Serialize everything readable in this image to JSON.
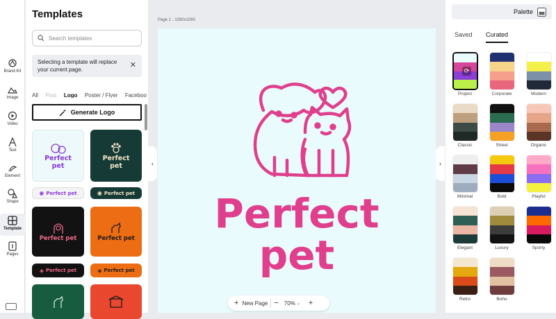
{
  "rail": [
    {
      "label": "Brand Kit",
      "icon": "brand-kit-icon"
    },
    {
      "label": "Image",
      "icon": "image-icon"
    },
    {
      "label": "Video",
      "icon": "video-icon"
    },
    {
      "label": "Text",
      "icon": "text-icon"
    },
    {
      "label": "Element",
      "icon": "element-icon"
    },
    {
      "label": "Shape",
      "icon": "shape-icon"
    },
    {
      "label": "Template",
      "icon": "template-icon",
      "active": true
    },
    {
      "label": "Pages",
      "icon": "pages-icon"
    }
  ],
  "templates": {
    "title": "Templates",
    "search_placeholder": "Search templates",
    "notice": "Selecting a template will replace your current page.",
    "tabs": [
      "All",
      "Post",
      "Logo",
      "Poster / Flyer",
      "Facebook"
    ],
    "active_tab": "Logo",
    "generate_label": "Generate Logo",
    "card_text": "Perfect pet",
    "card_text_a": "Perfect",
    "card_text_b": "pet"
  },
  "canvas": {
    "page_label": "Page 1 - 1080x1080",
    "headline_1": "Perfect",
    "headline_2": "pet",
    "brand_color": "#df3f8d",
    "background": "#e9fbfc"
  },
  "bottom_bar": {
    "new_page": "New Page",
    "zoom": "70%"
  },
  "palette": {
    "button_label": "Palette",
    "tabs": [
      "Saved",
      "Curated"
    ],
    "active_tab": "Curated",
    "swatches": [
      {
        "name": "Project",
        "colors": [
          "#e9fbfc",
          "#d6479c",
          "#8b3fd4",
          "#b9f04a"
        ],
        "selected": true
      },
      {
        "name": "Corporate",
        "colors": [
          "#1f3170",
          "#f6d48a",
          "#f59f8c",
          "#e9677c"
        ]
      },
      {
        "name": "Modern",
        "colors": [
          "#ffffff",
          "#f3f04a",
          "#7c90a8",
          "#1f2937"
        ]
      },
      {
        "name": "Classic",
        "colors": [
          "#e9dbc6",
          "#bfa07e",
          "#3c4b46",
          "#1f2a28"
        ]
      },
      {
        "name": "Street",
        "colors": [
          "#111111",
          "#2b6b4f",
          "#9a86c8",
          "#f4a126"
        ]
      },
      {
        "name": "Organic",
        "colors": [
          "#f7c7b8",
          "#e6a489",
          "#a9694d",
          "#5a3526"
        ]
      },
      {
        "name": "Minimal",
        "colors": [
          "#eeeeee",
          "#5f3b47",
          "#c9d6e3",
          "#9eadbd"
        ]
      },
      {
        "name": "Bold",
        "colors": [
          "#f5c90e",
          "#e63946",
          "#1d4ed8",
          "#0b0b0b"
        ]
      },
      {
        "name": "Playful",
        "colors": [
          "#ffa9c8",
          "#f871c0",
          "#8a6df0",
          "#f5f141"
        ]
      },
      {
        "name": "Elegant",
        "colors": [
          "#f5e3d3",
          "#2e5f55",
          "#ecb6a5",
          "#1c3a38"
        ]
      },
      {
        "name": "Luxury",
        "colors": [
          "#dccfb3",
          "#a08a3c",
          "#3c3c3c",
          "#121212"
        ]
      },
      {
        "name": "Sporty",
        "colors": [
          "#1c2d8f",
          "#ff6a00",
          "#d81b60",
          "#0a0a0a"
        ]
      },
      {
        "name": "Retro",
        "colors": [
          "#f3e7cf",
          "#e3a90e",
          "#d94c1a",
          "#3b1f14"
        ]
      },
      {
        "name": "Boho",
        "colors": [
          "#efdcc6",
          "#9b5a61",
          "#e2c1a2",
          "#6f3d3d"
        ]
      }
    ]
  }
}
